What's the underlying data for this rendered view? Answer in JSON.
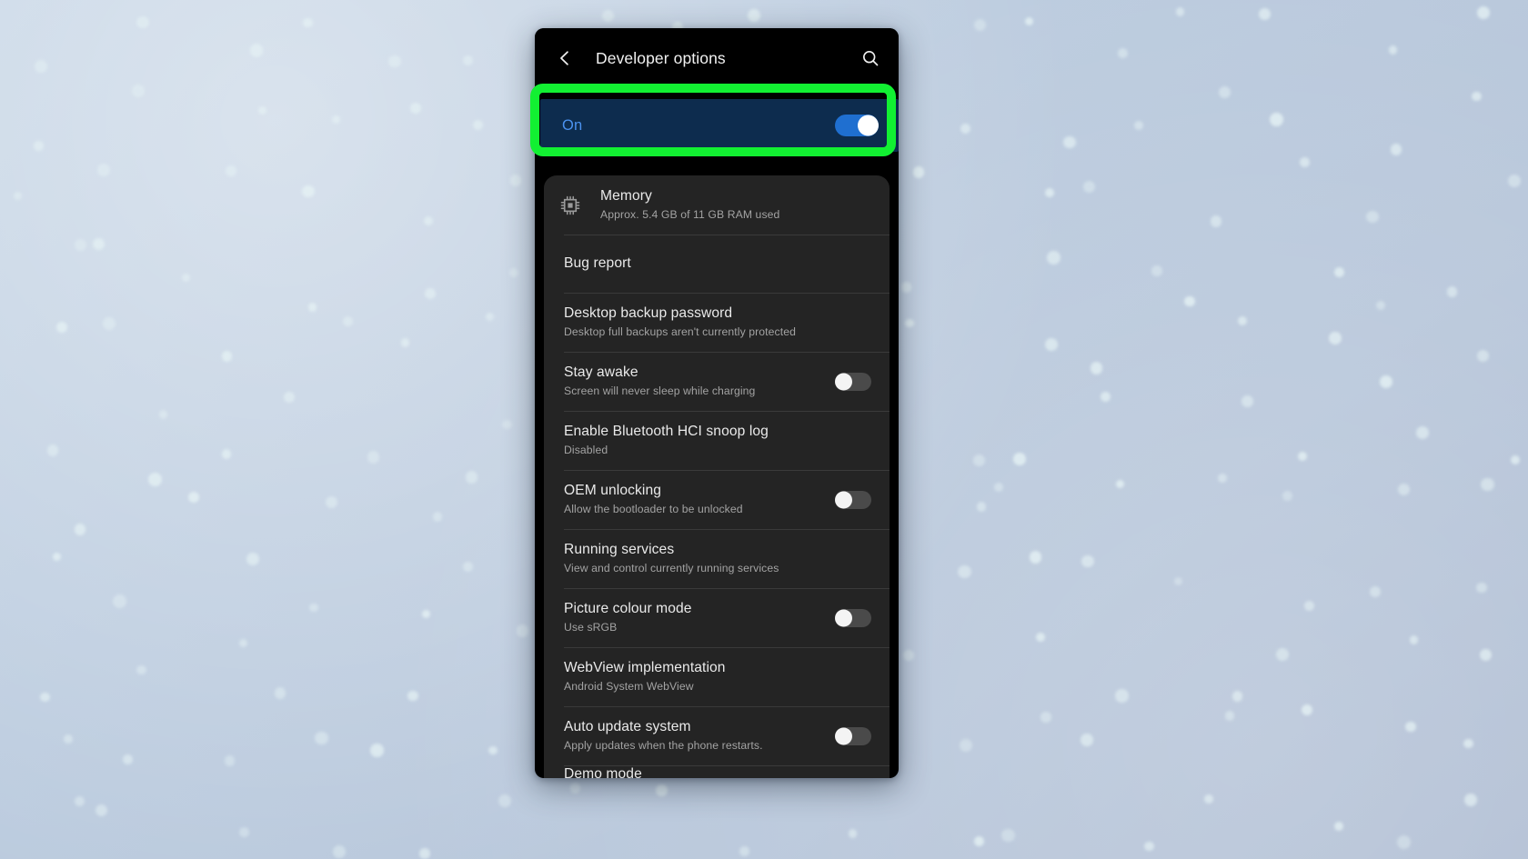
{
  "wallpaper": {
    "base_color": "#b9c8dc",
    "dot_color": "#e8f5f6"
  },
  "annotation": {
    "highlight_color": "#12f032",
    "target": "developer-options-master-switch"
  },
  "appbar": {
    "back_icon": "chevron-left-icon",
    "title": "Developer options",
    "search_icon": "search-icon",
    "background": "#000000"
  },
  "master_switch": {
    "label": "On",
    "label_color": "#4b92f0",
    "row_background": "#0d2c4e",
    "toggle": {
      "state": "on",
      "accent": "#1f6fd0"
    }
  },
  "list": {
    "background": "#242424",
    "items": [
      {
        "icon": "memory-chip-icon",
        "title": "Memory",
        "subtitle": "Approx. 5.4 GB of 11 GB RAM used",
        "control": "none"
      },
      {
        "icon": null,
        "title": "Bug report",
        "subtitle": null,
        "control": "none"
      },
      {
        "icon": null,
        "title": "Desktop backup password",
        "subtitle": "Desktop full backups aren't currently protected",
        "control": "none"
      },
      {
        "icon": null,
        "title": "Stay awake",
        "subtitle": "Screen will never sleep while charging",
        "control": "toggle",
        "toggle_state": "off"
      },
      {
        "icon": null,
        "title": "Enable Bluetooth HCI snoop log",
        "subtitle": "Disabled",
        "control": "none"
      },
      {
        "icon": null,
        "title": "OEM unlocking",
        "subtitle": "Allow the bootloader to be unlocked",
        "control": "toggle",
        "toggle_state": "off"
      },
      {
        "icon": null,
        "title": "Running services",
        "subtitle": "View and control currently running services",
        "control": "none"
      },
      {
        "icon": null,
        "title": "Picture colour mode",
        "subtitle": "Use sRGB",
        "control": "toggle",
        "toggle_state": "off"
      },
      {
        "icon": null,
        "title": "WebView implementation",
        "subtitle": "Android System WebView",
        "control": "none"
      },
      {
        "icon": null,
        "title": "Auto update system",
        "subtitle": "Apply updates when the phone restarts.",
        "control": "toggle",
        "toggle_state": "off"
      },
      {
        "icon": null,
        "title": "Demo mode",
        "subtitle": null,
        "control": "none",
        "partial": true
      }
    ]
  }
}
